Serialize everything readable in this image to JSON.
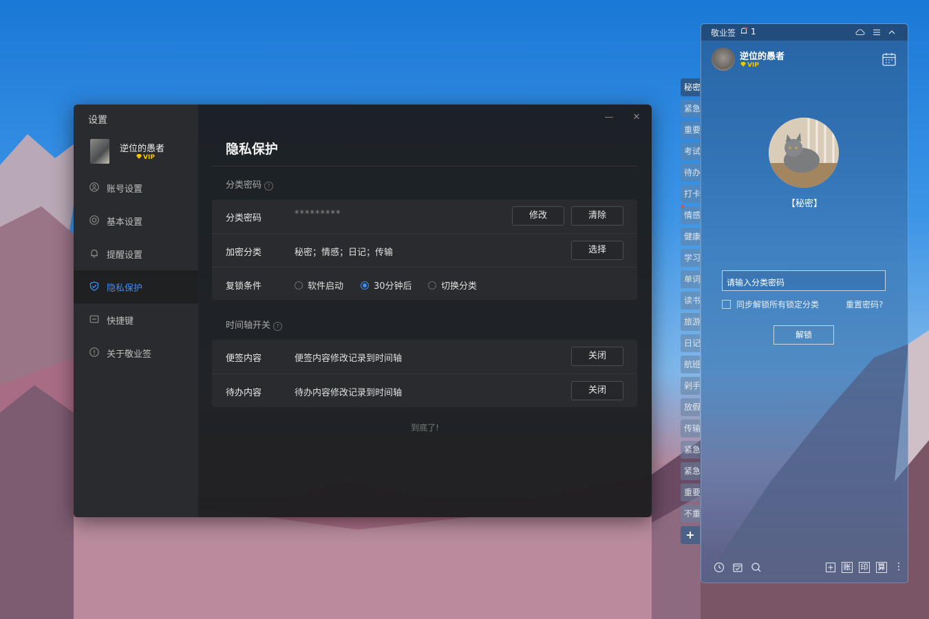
{
  "settings": {
    "title": "设置",
    "user": {
      "name": "逆位的愚者",
      "vip": "VIP"
    },
    "nav": [
      {
        "label": "账号设置",
        "icon": "user-icon"
      },
      {
        "label": "基本设置",
        "icon": "settings-hex-icon"
      },
      {
        "label": "提醒设置",
        "icon": "bell-icon"
      },
      {
        "label": "隐私保护",
        "icon": "shield-icon",
        "active": true
      },
      {
        "label": "快捷键",
        "icon": "keyboard-icon"
      },
      {
        "label": "关于敬业签",
        "icon": "info-icon"
      }
    ],
    "page_title": "隐私保护",
    "section1": {
      "label": "分类密码",
      "rows": {
        "password": {
          "label": "分类密码",
          "value": "*********",
          "modify": "修改",
          "clear": "清除"
        },
        "encrypted": {
          "label": "加密分类",
          "value": "秘密；情感；日记；传输",
          "select": "选择"
        },
        "relock": {
          "label": "复锁条件",
          "options": [
            "软件启动",
            "30分钟后",
            "切换分类"
          ],
          "selected": "30分钟后"
        }
      }
    },
    "section2": {
      "label": "时间轴开关",
      "rows": {
        "notes": {
          "label": "便签内容",
          "value": "便签内容修改记录到时间轴",
          "button": "关闭"
        },
        "todo": {
          "label": "待办内容",
          "value": "待办内容修改记录到时间轴",
          "button": "关闭"
        }
      }
    },
    "end_text": "到底了!"
  },
  "widget": {
    "title": "敬业签",
    "notification_count": "1",
    "user": {
      "name": "逆位的愚者",
      "vip": "VIP"
    },
    "category": "【秘密】",
    "password_placeholder": "请输入分类密码",
    "sync_unlock_label": "同步解锁所有锁定分类",
    "reset_password": "重置密码?",
    "unlock_button": "解锁",
    "tabs": [
      "秘密",
      "紧急",
      "重要",
      "考试",
      "待办",
      "打卡",
      "情感",
      "健康",
      "学习",
      "单词",
      "读书",
      "旅游",
      "日记",
      "航班",
      "剁手",
      "放假",
      "传输",
      "紧急",
      "紧急",
      "重要",
      "不重"
    ],
    "add_tab": "+",
    "tools": [
      "账",
      "印",
      "算"
    ],
    "more": "⋮"
  },
  "colors": {
    "accent": "#3f8cf5",
    "vip": "#f5c400",
    "window_bg": "#1c1d1f",
    "sidebar_bg": "#2a2b2e"
  }
}
